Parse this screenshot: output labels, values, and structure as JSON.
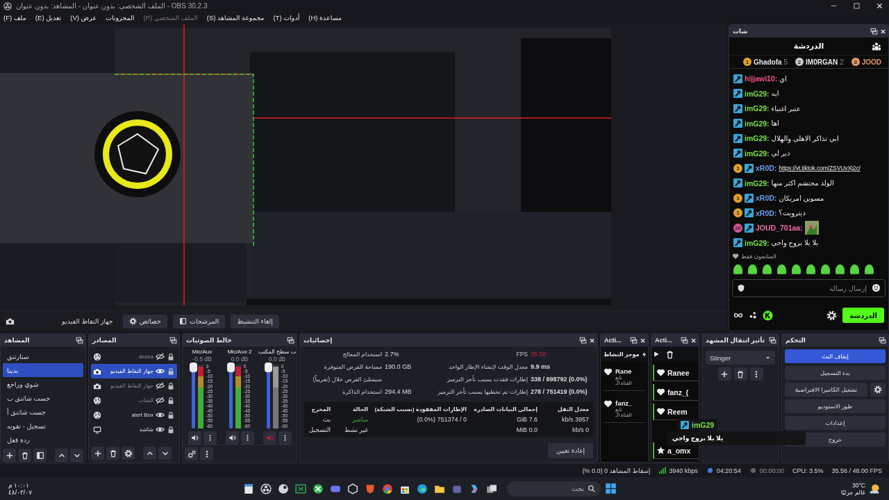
{
  "window": {
    "title": "الملف الشخصي: بدون عنوان - المشاهد: بدون عنوان - OBS 30.2.3"
  },
  "menu": [
    {
      "label": "مساعدة (H)",
      "disabled": false
    },
    {
      "label": "أدوات (T)",
      "disabled": false
    },
    {
      "label": "مجموعة المشاهد (S)",
      "disabled": false
    },
    {
      "label": "الملف الشخصي (P)",
      "disabled": true
    },
    {
      "label": "المحزونات",
      "disabled": false
    },
    {
      "label": "عرض (V)",
      "disabled": false
    },
    {
      "label": "تعديل (E)",
      "disabled": false
    },
    {
      "label": "ملف (F)",
      "disabled": false
    }
  ],
  "source_toolbar": {
    "source": "جهاز التقاط الفيديو",
    "buttons": [
      {
        "label": "إلغاء التنشيط",
        "kind": "plain"
      },
      {
        "label": "المرشحات",
        "kind": "filters"
      },
      {
        "label": "خصائص",
        "kind": "properties"
      }
    ]
  },
  "chat": {
    "dock_title": "شات",
    "title": "الدردشة",
    "leaders": [
      {
        "rank": "3",
        "name": "JOOD",
        "color": "#e49a66"
      },
      {
        "rank": "2",
        "name": "IM0RGAN",
        "count": "2",
        "color": "#c9c9c9"
      },
      {
        "rank": "1",
        "name": "Ghadofa",
        "count": "5",
        "color": "#e3a12a"
      }
    ],
    "messages": [
      {
        "user": "hijjawi10:",
        "color": "#f0537f",
        "kind": "text",
        "text": "اي"
      },
      {
        "user": "imG29:",
        "color": "#7be04a",
        "kind": "text",
        "text": "ايه"
      },
      {
        "user": "imG29:",
        "color": "#7be04a",
        "kind": "text",
        "text": "عتبر اغنياء"
      },
      {
        "user": "imG29:",
        "color": "#7be04a",
        "kind": "text",
        "text": "اها"
      },
      {
        "user": "imG29:",
        "color": "#7be04a",
        "kind": "text",
        "text": "ابي تذاكر الاهلي والهلال"
      },
      {
        "user": "imG29:",
        "color": "#7be04a",
        "kind": "text",
        "text": "دبر لي"
      },
      {
        "user": "xR0D:",
        "color": "#6a9fe8",
        "kind": "link",
        "text": "https://vt.tiktok.com/ZSVUvXj2c/",
        "badge": {
          "text": "1",
          "color": "#e3a12a"
        }
      },
      {
        "user": "imG29:",
        "color": "#7be04a",
        "kind": "text",
        "text": "الولد محتشم اكثر منها"
      },
      {
        "user": "xR0D:",
        "color": "#6a9fe8",
        "kind": "text",
        "text": "مسوين امريكان",
        "badge": {
          "text": "1",
          "color": "#e3a12a"
        }
      },
      {
        "user": "xR0D:",
        "color": "#6a9fe8",
        "kind": "text",
        "text": "ديترويت؟",
        "badge": {
          "text": "1",
          "color": "#e3a12a"
        }
      },
      {
        "user": "JOUD_701aa:",
        "color": "#f06aa8",
        "kind": "sticker",
        "badge": {
          "text": "20",
          "color": "#d8579a"
        }
      },
      {
        "user": "imG29:",
        "color": "#7be04a",
        "kind": "text",
        "text": "يلا يلا بروح واجي"
      }
    ],
    "followers_only": "المتابعون فقط",
    "input": {
      "placeholder": "إرسال رسالة"
    },
    "send_button": "الدردشة"
  },
  "scenes": {
    "title": "المشاهد",
    "items": [
      {
        "label": "ستارتنق",
        "selected": false
      },
      {
        "label": "بدينا",
        "selected": true
      },
      {
        "label": "شوي وراجع",
        "selected": false
      },
      {
        "label": "جست شاتنق ب",
        "selected": false
      },
      {
        "label": "جست شاتنق أ",
        "selected": false
      },
      {
        "label": "تسجيل - تقويه",
        "selected": false
      },
      {
        "label": "ردة فعل",
        "selected": false
      }
    ]
  },
  "sources": {
    "title": "المصادر",
    "items": [
      {
        "label": "asasa",
        "kind": "browser",
        "visible": false,
        "selected": false
      },
      {
        "label": "جهاز التقاط الفيديو",
        "kind": "capture",
        "visible": true,
        "selected": true
      },
      {
        "label": "جهاز التقاط الفيديو",
        "kind": "capture",
        "visible": false,
        "selected": false
      },
      {
        "label": "الشات",
        "kind": "browser",
        "visible": false,
        "selected": false
      },
      {
        "label": "alert Box",
        "kind": "browser",
        "visible": true,
        "selected": false
      },
      {
        "label": "شاشة",
        "kind": "display",
        "visible": true,
        "selected": false
      }
    ]
  },
  "mixer": {
    "title": "خالط الصوتيات",
    "channels": [
      {
        "name": "ت سطح المكتب",
        "reading": "0.0 dB",
        "muted": true,
        "fader": {
          "level": 0.96
        },
        "meter": {
          "level": 0.97
        },
        "scale": [
          "0",
          "-5",
          "-10",
          "-15",
          "-20",
          "-25",
          "-30",
          "-35",
          "-40",
          "-45",
          "-50",
          "-55",
          "-60"
        ]
      },
      {
        "name": "Mic/Aux 2",
        "reading": "0.0 dB",
        "muted": false,
        "fader": {
          "level": 0.96
        },
        "meter": {
          "level": 0.97
        },
        "scale": [
          "0",
          "-5",
          "-10",
          "-15",
          "-20",
          "-25",
          "-30",
          "-35",
          "-40",
          "-45",
          "-50",
          "-55",
          "-60"
        ]
      },
      {
        "name": "Mic/Aux",
        "reading": "-0.5 dB",
        "muted": false,
        "fader": {
          "level": 0.96
        },
        "meter": {
          "level": 0.97
        },
        "scale": [
          "0",
          "-5",
          "-10",
          "-15",
          "-20",
          "-25",
          "-30",
          "-35",
          "-40",
          "-45",
          "-50",
          "-55",
          "-60"
        ]
      }
    ]
  },
  "stats": {
    "title": "إحصائيات",
    "left": [
      {
        "label": "استخدام المعالج",
        "value": "2.7%"
      },
      {
        "label": "مساحة القرص المتوفرة",
        "value": "190.0 GB"
      },
      {
        "label": "سيمتلئ القرص خلال (تقريباً)"
      },
      {
        "label": "استخدام الذاكرة",
        "value": "294.4 MB"
      }
    ],
    "right": [
      {
        "label": "FPS",
        "value": "35.56",
        "warn": true
      },
      {
        "label": "معدل الوقت لإنشاء الإطار الواحد",
        "value": "9.9 ms",
        "warn": false
      },
      {
        "label": "إطارات فقدت بسبب تأخر الترميز",
        "value": "338 / 898792 (0.0%)",
        "warn": false
      },
      {
        "label": "إطارات تم تخطيها بسبب تأخر الترميز",
        "value": "278 / 751419 (0.0%)",
        "warn": false
      }
    ],
    "outputs": {
      "columns": [
        "معدل النقل",
        "إجمالي البيانات الصادرة",
        "الإطارات المفقودة (بسبب الشبكة)",
        "الحالة",
        "المخرج"
      ],
      "rows": [
        {
          "output": "بث",
          "status": "مباشر",
          "live": true,
          "dropped": "0 / 751374 (0.0%)",
          "total": "7.6 GiB",
          "bitrate": "3957 kb/s"
        },
        {
          "output": "التسجيل",
          "status": "غير نشط",
          "live": false,
          "total": "0.0 MiB",
          "bitrate": "0 kb/s"
        }
      ]
    },
    "reset_button": "إعادة تعيين"
  },
  "activity": [
    {
      "title": "Acti...",
      "kind": "queue",
      "items": [
        {
          "name": "Ranee",
          "kind": "follow"
        },
        {
          "name": "fanz_(",
          "kind": "follow"
        },
        {
          "name": "Reem",
          "kind": "follow"
        },
        {
          "name": "a_omx",
          "kind": "subscribe"
        }
      ]
    },
    {
      "title": "Acti...",
      "kind": "feed",
      "header": "موجز النشاط",
      "items": [
        {
          "name": "Rane",
          "line1": "تابع",
          "line2": "القناة الـ"
        },
        {
          "name": "fanz_",
          "line1": "تابع",
          "line2": "القناة الـ"
        }
      ]
    }
  ],
  "transition": {
    "title": "تأثير انتقال المشهد",
    "selected": "Stinger"
  },
  "controls": {
    "title": "التحكم",
    "buttons": [
      {
        "label": "إيقاف البث",
        "active": true,
        "kind": "plain"
      },
      {
        "label": "بدء التسجيل",
        "active": false,
        "kind": "plain"
      },
      {
        "label": "تشغيل الكاميرا الافتراضية",
        "active": false,
        "kind": "with_settings"
      },
      {
        "label": "طور الاستوديو",
        "active": false,
        "kind": "plain"
      },
      {
        "label": "إعدادات",
        "active": false,
        "kind": "plain"
      },
      {
        "label": "خروج",
        "active": false,
        "kind": "plain"
      }
    ]
  },
  "chat_popup": {
    "user": "imG29",
    "text": "يلا يلا بروح واجي"
  },
  "status_bar": {
    "dropped": "إسقاط المشاهد 0 (0.0 %)",
    "bitrate": "3940 kbps",
    "stream_time": "04:20:54",
    "record_time": "00:00:00",
    "cpu": "CPU: 3.5%",
    "fps": "35.56 / 48.00 FPS"
  },
  "taskbar": {
    "time": "١٠:٠١ م",
    "date": "٤٨/٠٣/٠٧",
    "search_placeholder": "بحث",
    "temperature": "30°C",
    "weather": "غائم جزئيًا"
  }
}
